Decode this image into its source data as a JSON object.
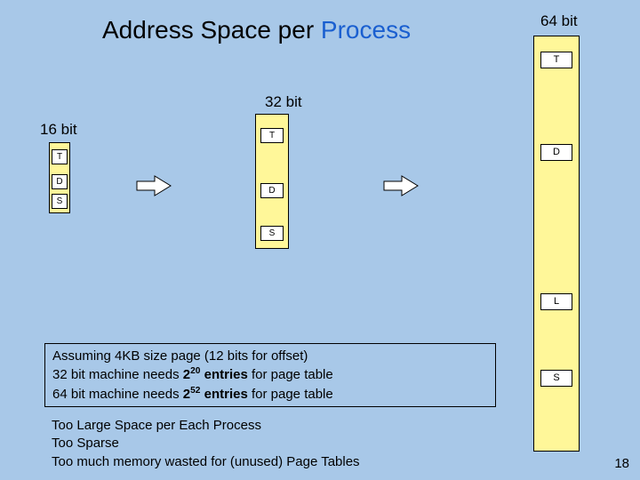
{
  "title_pre": "Address Space per ",
  "title_accent": "Process",
  "labels": {
    "b64": "64 bit",
    "b32": "32 bit",
    "b16": "16 bit"
  },
  "bar64": {
    "T": "T",
    "D": "D",
    "L": "L",
    "S": "S"
  },
  "bar32": {
    "T": "T",
    "D": "D",
    "S": "S"
  },
  "bar16": {
    "T": "T",
    "D": "D",
    "S": "S"
  },
  "box1": {
    "l1": "Assuming 4KB size page (12 bits for offset)",
    "l2a": "32 bit machine needs ",
    "l2b_base": "2",
    "l2b_exp": "20",
    "l2c": " entries",
    "l2d": " for page table",
    "l3a": "64 bit machine needs ",
    "l3b_base": "2",
    "l3b_exp": "52",
    "l3c": " entries",
    "l3d": " for page table"
  },
  "box2": {
    "l1": "Too Large  Space per Each Process",
    "l2": "Too Sparse",
    "l3": "Too much memory wasted for (unused) Page Tables"
  },
  "page": "18"
}
